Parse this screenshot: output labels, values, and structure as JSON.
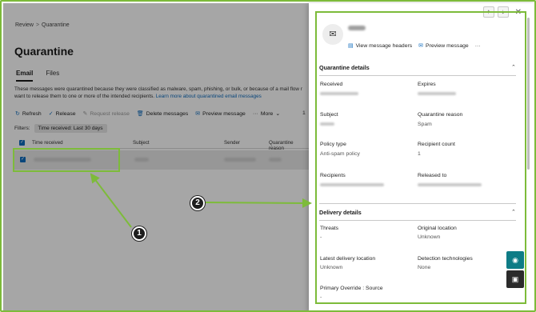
{
  "breadcrumb": [
    "Review",
    "Quarantine"
  ],
  "page_title": "Quarantine",
  "tabs": [
    {
      "label": "Email",
      "active": true
    },
    {
      "label": "Files",
      "active": false
    }
  ],
  "description": {
    "line1": "These messages were quarantined because they were classified as malware, spam, phishing, or bulk, or because of a mail flow r",
    "line2_prefix": "want to release them to one or more of the intended recipients. ",
    "link": "Learn more about quarantined email messages"
  },
  "toolbar": {
    "refresh": "Refresh",
    "release": "Release",
    "request_release": "Request release",
    "delete": "Delete messages",
    "preview": "Preview message",
    "more": "More",
    "count": "1"
  },
  "filters": {
    "label": "Filters:",
    "chip": "Time received: Last 30 days"
  },
  "table": {
    "columns": [
      "Time received",
      "Subject",
      "Sender",
      "Quarantine reason"
    ]
  },
  "panel": {
    "actions": {
      "headers": "View message headers",
      "preview": "Preview message",
      "more": "···"
    },
    "quarantine_details": {
      "title": "Quarantine details",
      "received_label": "Received",
      "expires_label": "Expires",
      "subject_label": "Subject",
      "reason_label": "Quarantine reason",
      "reason_value": "Spam",
      "policy_type_label": "Policy type",
      "policy_type_value": "Anti-spam policy",
      "recipient_count_label": "Recipient count",
      "recipient_count_value": "1",
      "recipients_label": "Recipients",
      "released_to_label": "Released to"
    },
    "delivery_details": {
      "title": "Delivery details",
      "threats_label": "Threats",
      "threats_value": "-",
      "original_location_label": "Original location",
      "original_location_value": "Unknown",
      "latest_delivery_label": "Latest delivery location",
      "latest_delivery_value": "Unknown",
      "detection_label": "Detection technologies",
      "detection_value": "None",
      "override_label": "Primary Override : Source",
      "override_value": "-"
    }
  },
  "callouts": [
    "1",
    "2"
  ],
  "colors": {
    "accent": "#0f6cbd",
    "highlight": "#7dbb3a",
    "fab_teal": "#0e7c86",
    "fab_dark": "#2b2b2b"
  }
}
